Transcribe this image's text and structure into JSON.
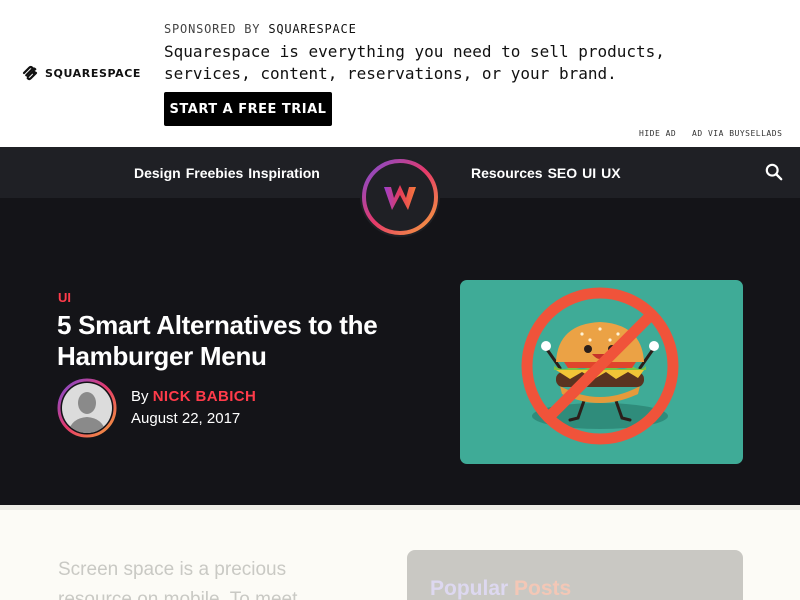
{
  "ad": {
    "logo_text": "SQUARESPACE",
    "sponsored_label": "SPONSORED BY",
    "sponsor_name": "SQUARESPACE",
    "copy": "Squarespace is everything you need to sell products, services, content, reservations, or your brand.",
    "cta_label": "START A FREE TRIAL",
    "hide_ad_label": "HIDE AD",
    "via_label": "AD VIA BUYSELLADS"
  },
  "nav": {
    "left_items": [
      "Design",
      "Freebies",
      "Inspiration"
    ],
    "right_items": [
      "Resources",
      "SEO",
      "UI",
      "UX"
    ],
    "logo_icon": "w-logo-icon",
    "search_icon": "search-icon"
  },
  "article": {
    "category": "UI",
    "title": "5 Smart Alternatives to the Hamburger Menu",
    "by_label": "By",
    "author": "NICK BABICH",
    "date": "August 22, 2017",
    "feature_image": "no-hamburger-illustration"
  },
  "body": {
    "excerpt": "Screen space is a precious resource on mobile. To meet"
  },
  "sidebar": {
    "popular_title_a": "Popular",
    "popular_title_b": "Posts"
  },
  "colors": {
    "accent": "#ff3b4a",
    "nav_bg": "#1f2025",
    "hero_bg": "#141418",
    "feature_bg": "#3fab97"
  }
}
